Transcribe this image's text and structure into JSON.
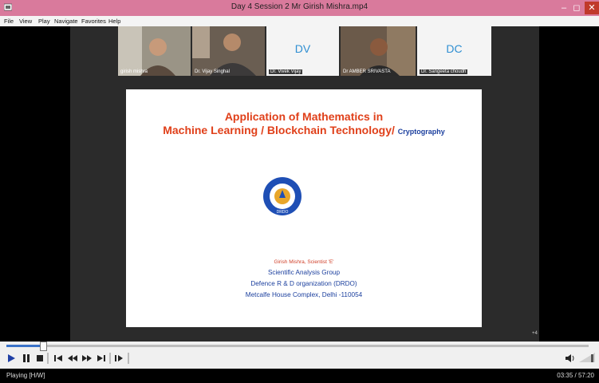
{
  "window": {
    "title": "Day 4 Session 2 Mr Girish Mishra.mp4",
    "minimize": "–",
    "maximize": "◻",
    "close": "✕",
    "accent": "#d97a9c"
  },
  "menu": [
    "File",
    "View",
    "Play",
    "Navigate",
    "Favorites",
    "Help"
  ],
  "participants": [
    {
      "name": "girish mishra"
    },
    {
      "name": "Dr. Vijay Singhal"
    },
    {
      "name": "Dr. Vivek Vijay",
      "initials": "DV"
    },
    {
      "name": "Dr AMBER SRIVASTA"
    },
    {
      "name": "Dr. Sangeeta choudh",
      "initials": "DC"
    }
  ],
  "slide": {
    "title_line1": "Application of Mathematics in",
    "title_line2": "Machine Learning / Blockchain Technology/",
    "title_crypto": "Cryptography",
    "emblem_text": "DRDO",
    "author": "Girish Mishra, Scientist 'E'",
    "group": "Scientific Analysis Group",
    "org": "Defence R & D organization (DRDO)",
    "address": "Metcalfe House Complex, Delhi -110054"
  },
  "player": {
    "status": "Playing [H/W]",
    "time": "03:35 / 57:20",
    "progress_fraction": 0.063,
    "overlay_count": "+4"
  },
  "icons": {
    "play": "play-icon",
    "pause": "pause-icon",
    "stop": "stop-icon"
  }
}
